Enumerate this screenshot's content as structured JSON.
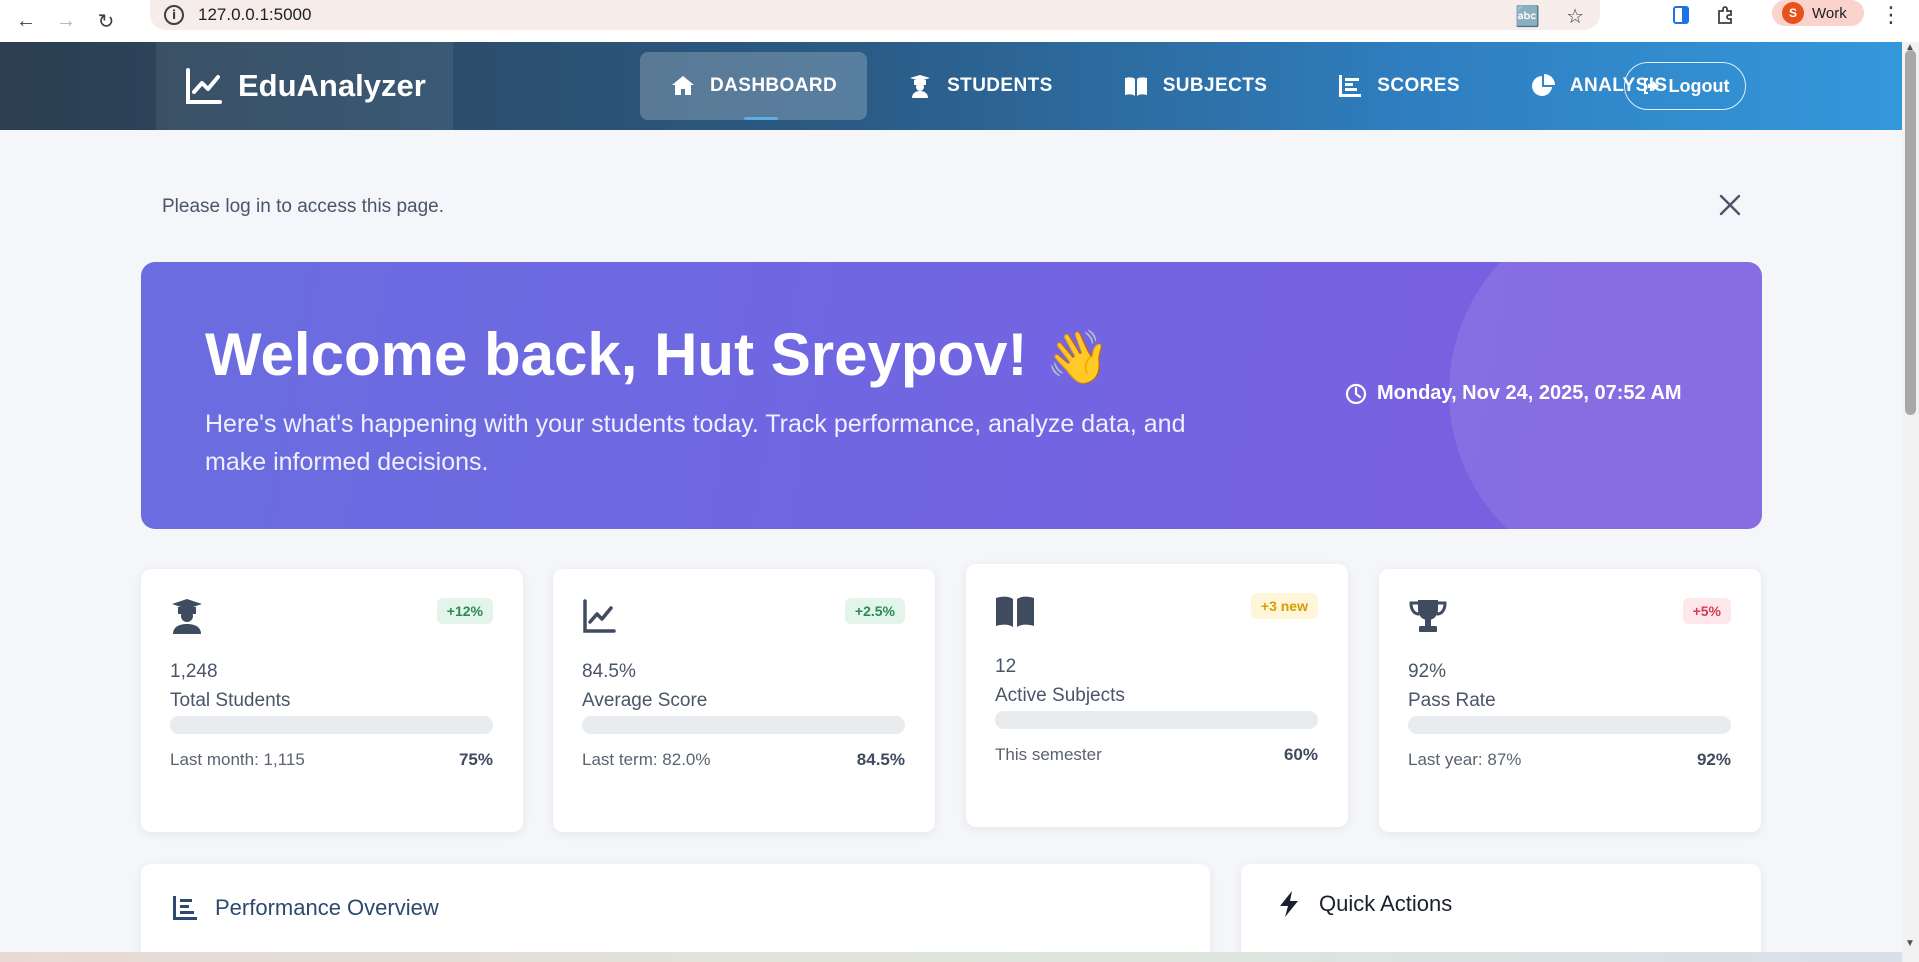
{
  "browser": {
    "url": "127.0.0.1:5000",
    "profile_initial": "S",
    "profile_name": "Work"
  },
  "navbar": {
    "brand": "EduAnalyzer",
    "links": [
      {
        "label": "DASHBOARD",
        "icon": "home-icon",
        "active": true
      },
      {
        "label": "STUDENTS",
        "icon": "graduate-icon",
        "active": false
      },
      {
        "label": "SUBJECTS",
        "icon": "book-icon",
        "active": false
      },
      {
        "label": "SCORES",
        "icon": "bar-chart-icon",
        "active": false
      },
      {
        "label": "ANALYSIS",
        "icon": "pie-chart-icon",
        "active": false
      }
    ],
    "logout_label": "Logout"
  },
  "alert": {
    "message": "Please log in to access this page."
  },
  "hero": {
    "title": "Welcome back, Hut Sreypov!",
    "emoji": "👋",
    "subtitle": "Here's what's happening with your students today. Track performance, analyze data, and make informed decisions.",
    "datetime": "Monday, Nov 24, 2025, 07:52 AM"
  },
  "stats": [
    {
      "icon": "graduate-icon",
      "badge": "+12%",
      "badge_color": "#2a8a52",
      "value": "1,248",
      "label": "Total Students",
      "foot": "Last month: 1,115",
      "percent": "75%"
    },
    {
      "icon": "line-chart-icon",
      "badge": "+2.5%",
      "badge_color": "#2a8a52",
      "value": "84.5%",
      "label": "Average Score",
      "foot": "Last term: 82.0%",
      "percent": "84.5%"
    },
    {
      "icon": "book-icon",
      "badge": "+3 new",
      "badge_color": "#d39e00",
      "value": "12",
      "label": "Active Subjects",
      "foot": "This semester",
      "percent": "60%"
    },
    {
      "icon": "trophy-icon",
      "badge": "+5%",
      "badge_color": "#d63c55",
      "value": "92%",
      "label": "Pass Rate",
      "foot": "Last year: 87%",
      "percent": "92%"
    }
  ],
  "panels": {
    "performance_title": "Performance Overview",
    "quick_actions_title": "Quick Actions"
  },
  "colors": {
    "navbar_start": "#2c3e50",
    "navbar_end": "#3498db",
    "hero_start": "#6a6ddf",
    "hero_end": "#7d5ee0"
  }
}
